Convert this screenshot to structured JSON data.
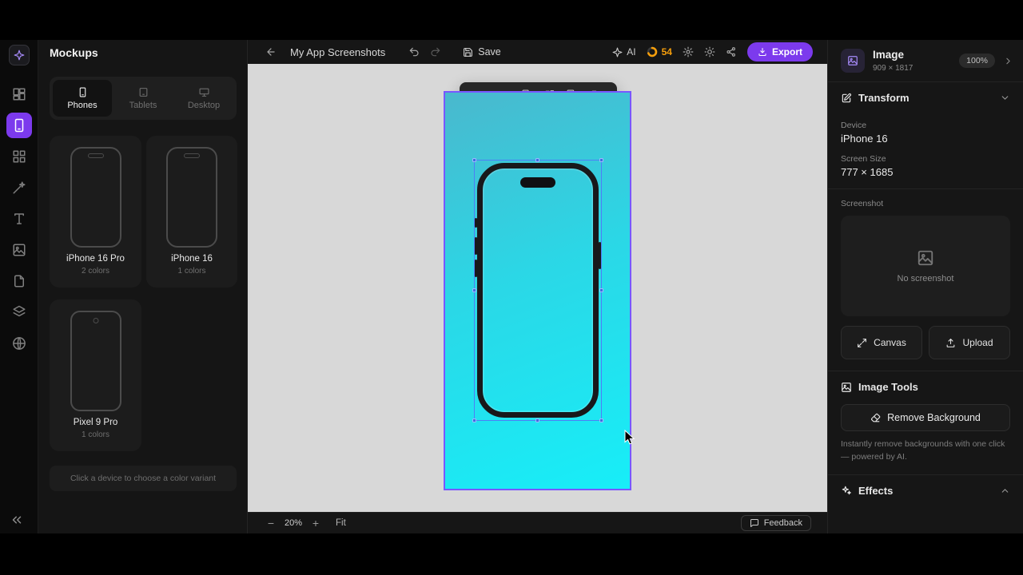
{
  "left_panel": {
    "title": "Mockups",
    "tabs": [
      {
        "label": "Phones",
        "active": true,
        "icon": "phone-icon"
      },
      {
        "label": "Tablets",
        "active": false,
        "icon": "tablet-icon"
      },
      {
        "label": "Desktop",
        "active": false,
        "icon": "monitor-icon"
      }
    ],
    "devices": [
      {
        "name": "iPhone 16 Pro",
        "colors": "2 colors"
      },
      {
        "name": "iPhone 16",
        "colors": "1 colors"
      },
      {
        "name": "Pixel 9 Pro",
        "colors": "1 colors"
      }
    ],
    "hint": "Click a device to choose a color variant"
  },
  "toolbar": {
    "project_name": "My App Screenshots",
    "save_label": "Save",
    "ai_label": "AI",
    "credits": "54",
    "export_label": "Export"
  },
  "canvas": {
    "zoom_out": "−",
    "zoom_value": "20%",
    "zoom_in": "+",
    "fit_label": "Fit",
    "feedback_label": "Feedback"
  },
  "right_panel": {
    "title": "Image",
    "dimensions": "909 × 1817",
    "scale_badge": "100%",
    "transform_label": "Transform",
    "device_label": "Device",
    "device_value": "iPhone 16",
    "screen_size_label": "Screen Size",
    "screen_size_value": "777 × 1685",
    "screenshot_label": "Screenshot",
    "no_screenshot": "No screenshot",
    "canvas_button": "Canvas",
    "upload_button": "Upload",
    "image_tools_label": "Image Tools",
    "remove_bg_label": "Remove Background",
    "remove_bg_desc": "Instantly remove backgrounds with one click — powered by AI.",
    "effects_label": "Effects"
  },
  "icons": {
    "rail": [
      "dashboard-icon",
      "mockups-icon",
      "templates-icon",
      "magic-wand-icon",
      "text-tool-icon",
      "image-tool-icon",
      "pages-icon",
      "layers-icon",
      "globe-icon",
      "collapse-icon"
    ],
    "top_toolbar": [
      "back-icon",
      "undo-icon",
      "redo-icon",
      "save-icon",
      "sparkle-icon",
      "credits-ring-icon",
      "gear-icon",
      "sun-icon",
      "share-icon",
      "download-icon"
    ],
    "floating_toolbar": [
      "bring-forward-icon",
      "send-backward-icon",
      "copy-icon",
      "paste-style-icon",
      "duplicate-icon",
      "delete-icon"
    ],
    "right_panel": [
      "image-icon",
      "chevron-right-icon",
      "square-pen-icon",
      "chevron-down-icon",
      "maximize-icon",
      "upload-icon",
      "eraser-icon",
      "sparkles-icon",
      "chevron-up-icon"
    ]
  },
  "colors": {
    "accent_purple": "#7c3aed",
    "selection_blue": "#4d7ef7",
    "artboard_border": "#7857ff",
    "artboard_gradient_start": "#4ab8cd",
    "artboard_gradient_end": "#17eef8",
    "credits_orange": "#f59e0b",
    "canvas_gray": "#d8d8d8"
  }
}
